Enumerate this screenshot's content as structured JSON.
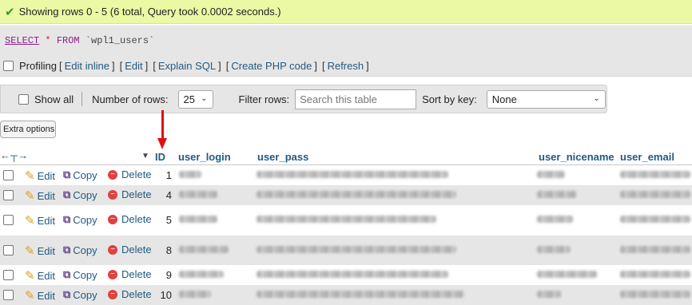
{
  "message": {
    "text": "Showing rows 0 - 5 (6 total, Query took 0.0002 seconds.)"
  },
  "sql": {
    "select": "SELECT",
    "star": "*",
    "from": "FROM",
    "table": "`wpl1_users`"
  },
  "profiling": {
    "label": "Profiling",
    "links": [
      "Edit inline",
      "Edit",
      "Explain SQL",
      "Create PHP code",
      "Refresh"
    ]
  },
  "nav": {
    "show_all": "Show all",
    "rows_label": "Number of rows:",
    "rows_value": "25",
    "filter_label": "Filter rows:",
    "filter_placeholder": "Search this table",
    "sort_label": "Sort by key:",
    "sort_value": "None"
  },
  "extra_options": "Extra options",
  "columns": [
    "ID",
    "user_login",
    "user_pass",
    "user_nicename",
    "user_email"
  ],
  "sort_indicator": "▼",
  "row_actions": {
    "edit": "Edit",
    "copy": "Copy",
    "delete": "Delete"
  },
  "rows": [
    {
      "id": "1"
    },
    {
      "id": "4"
    },
    {
      "id": "5"
    },
    {
      "id": "8"
    },
    {
      "id": "9"
    },
    {
      "id": "10"
    }
  ],
  "colors": {
    "success_bg": "#ebf8a4",
    "link": "#235a81",
    "arrow": "#e01010",
    "row_alt": "#e6e6e6"
  }
}
